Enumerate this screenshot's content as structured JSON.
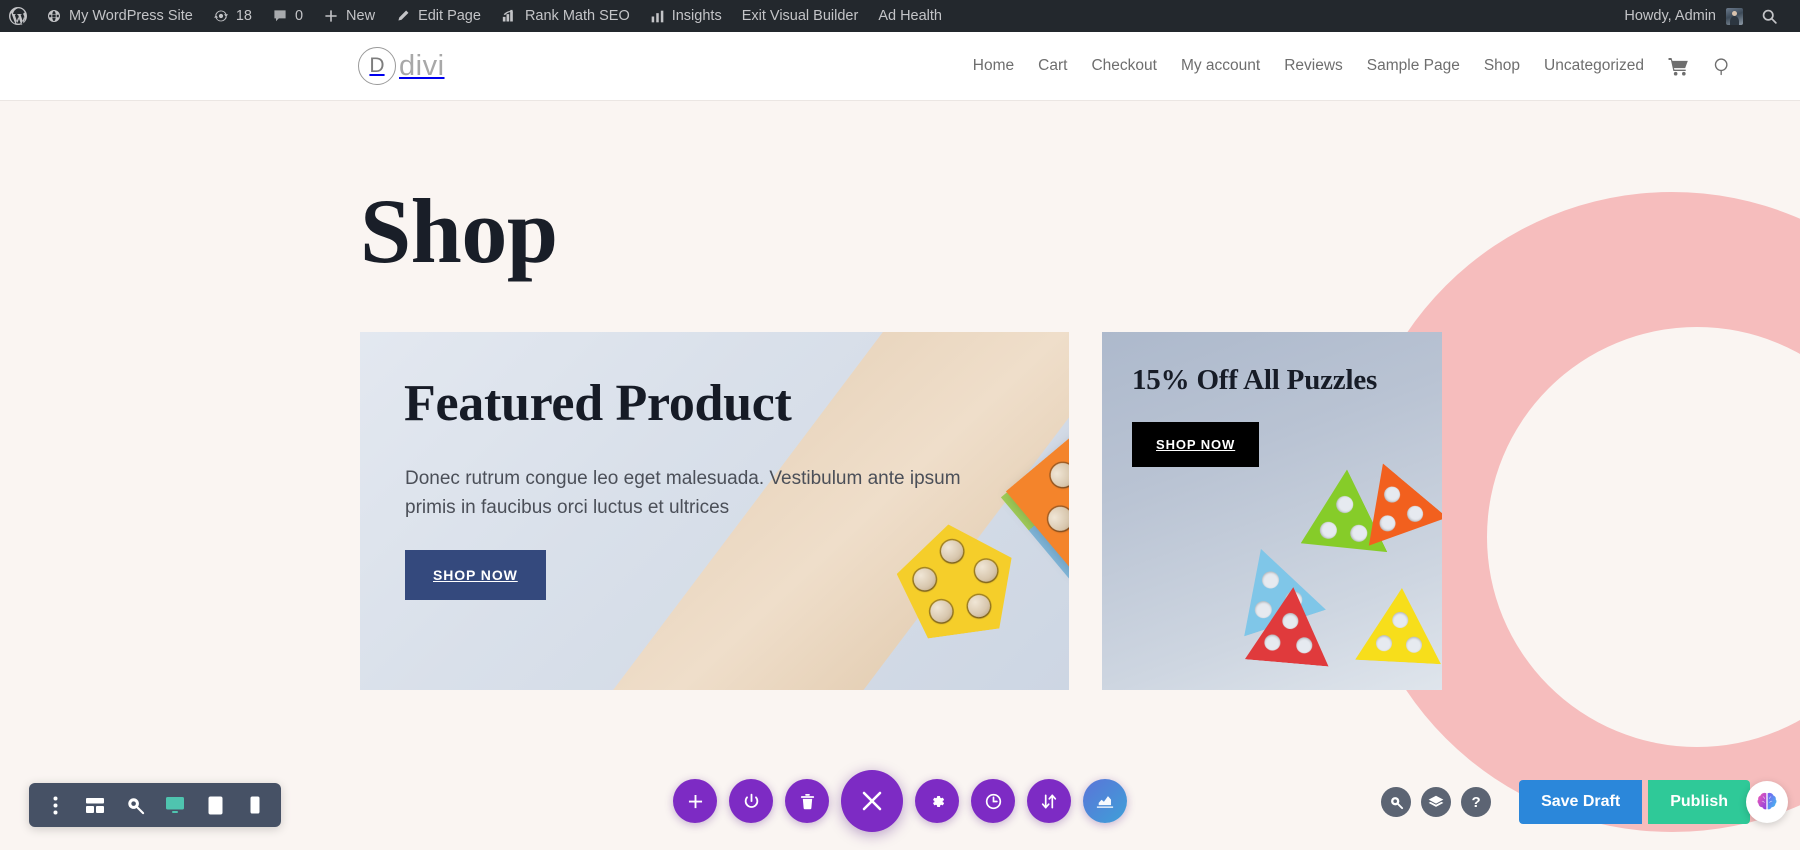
{
  "adminbar": {
    "left_items": [
      {
        "icon": "wordpress-logo-icon",
        "label": ""
      },
      {
        "icon": "site-icon",
        "label": "My WordPress Site"
      },
      {
        "icon": "updates-icon",
        "label": "18"
      },
      {
        "icon": "comments-icon",
        "label": "0"
      },
      {
        "icon": "plus-icon",
        "label": "New"
      },
      {
        "icon": "pencil-icon",
        "label": "Edit Page"
      },
      {
        "icon": "rankmath-icon",
        "label": "Rank Math SEO"
      },
      {
        "icon": "insights-chart-icon",
        "label": "Insights"
      },
      {
        "icon": "",
        "label": "Exit Visual Builder"
      },
      {
        "icon": "",
        "label": "Ad Health"
      }
    ],
    "howdy": "Howdy, Admin",
    "search_icon": "search-icon"
  },
  "site_header": {
    "logo_letter": "D",
    "logo_word": "divi",
    "nav": [
      "Home",
      "Cart",
      "Checkout",
      "My account",
      "Reviews",
      "Sample Page",
      "Shop",
      "Uncategorized"
    ],
    "cart_icon": "shopping-cart-icon",
    "search_icon": "search-icon"
  },
  "page": {
    "title": "Shop"
  },
  "featured_card": {
    "title": "Featured Product",
    "description": "Donec rutrum congue leo eget malesuada. Vestibulum ante ipsum primis in faucibus orci luctus et ultrices",
    "cta": "SHOP NOW",
    "cta_color": "#34497D"
  },
  "promo_card": {
    "title": "15% Off All Puzzles",
    "cta": "SHOP NOW",
    "cta_color": "#000000"
  },
  "divi_left_toolbar": [
    {
      "name": "more-options-icon",
      "label": ""
    },
    {
      "name": "wireframe-view-icon",
      "label": ""
    },
    {
      "name": "zoom-out-view-icon",
      "label": ""
    },
    {
      "name": "desktop-view-icon",
      "label": "",
      "active": true
    },
    {
      "name": "tablet-view-icon",
      "label": ""
    },
    {
      "name": "phone-view-icon",
      "label": ""
    }
  ],
  "divi_center_toolbar": [
    {
      "name": "add-section-icon"
    },
    {
      "name": "power-toggle-icon"
    },
    {
      "name": "trash-icon"
    },
    {
      "name": "close-menu-icon",
      "big": true
    },
    {
      "name": "settings-gear-icon"
    },
    {
      "name": "history-clock-icon"
    },
    {
      "name": "save-load-arrows-icon"
    },
    {
      "name": "portability-icon"
    }
  ],
  "divi_right_toolbar": {
    "icons": [
      {
        "name": "search-icon",
        "glyph": ""
      },
      {
        "name": "layers-icon",
        "glyph": ""
      },
      {
        "name": "help-icon",
        "glyph": "?"
      }
    ],
    "save_draft": "Save Draft",
    "publish": "Publish",
    "save_draft_color": "#2B87DA",
    "publish_color": "#2FC998",
    "brain_icon": "ai-brain-icon"
  },
  "theme_colors": {
    "page_bg": "#FAF5F2",
    "pink_ring": "#F6BDBD",
    "adminbar_bg": "#23282D",
    "divi_purple": "#7D2BC4",
    "divi_toolbar_gray": "#465165",
    "active_teal": "#4FC4AF"
  }
}
